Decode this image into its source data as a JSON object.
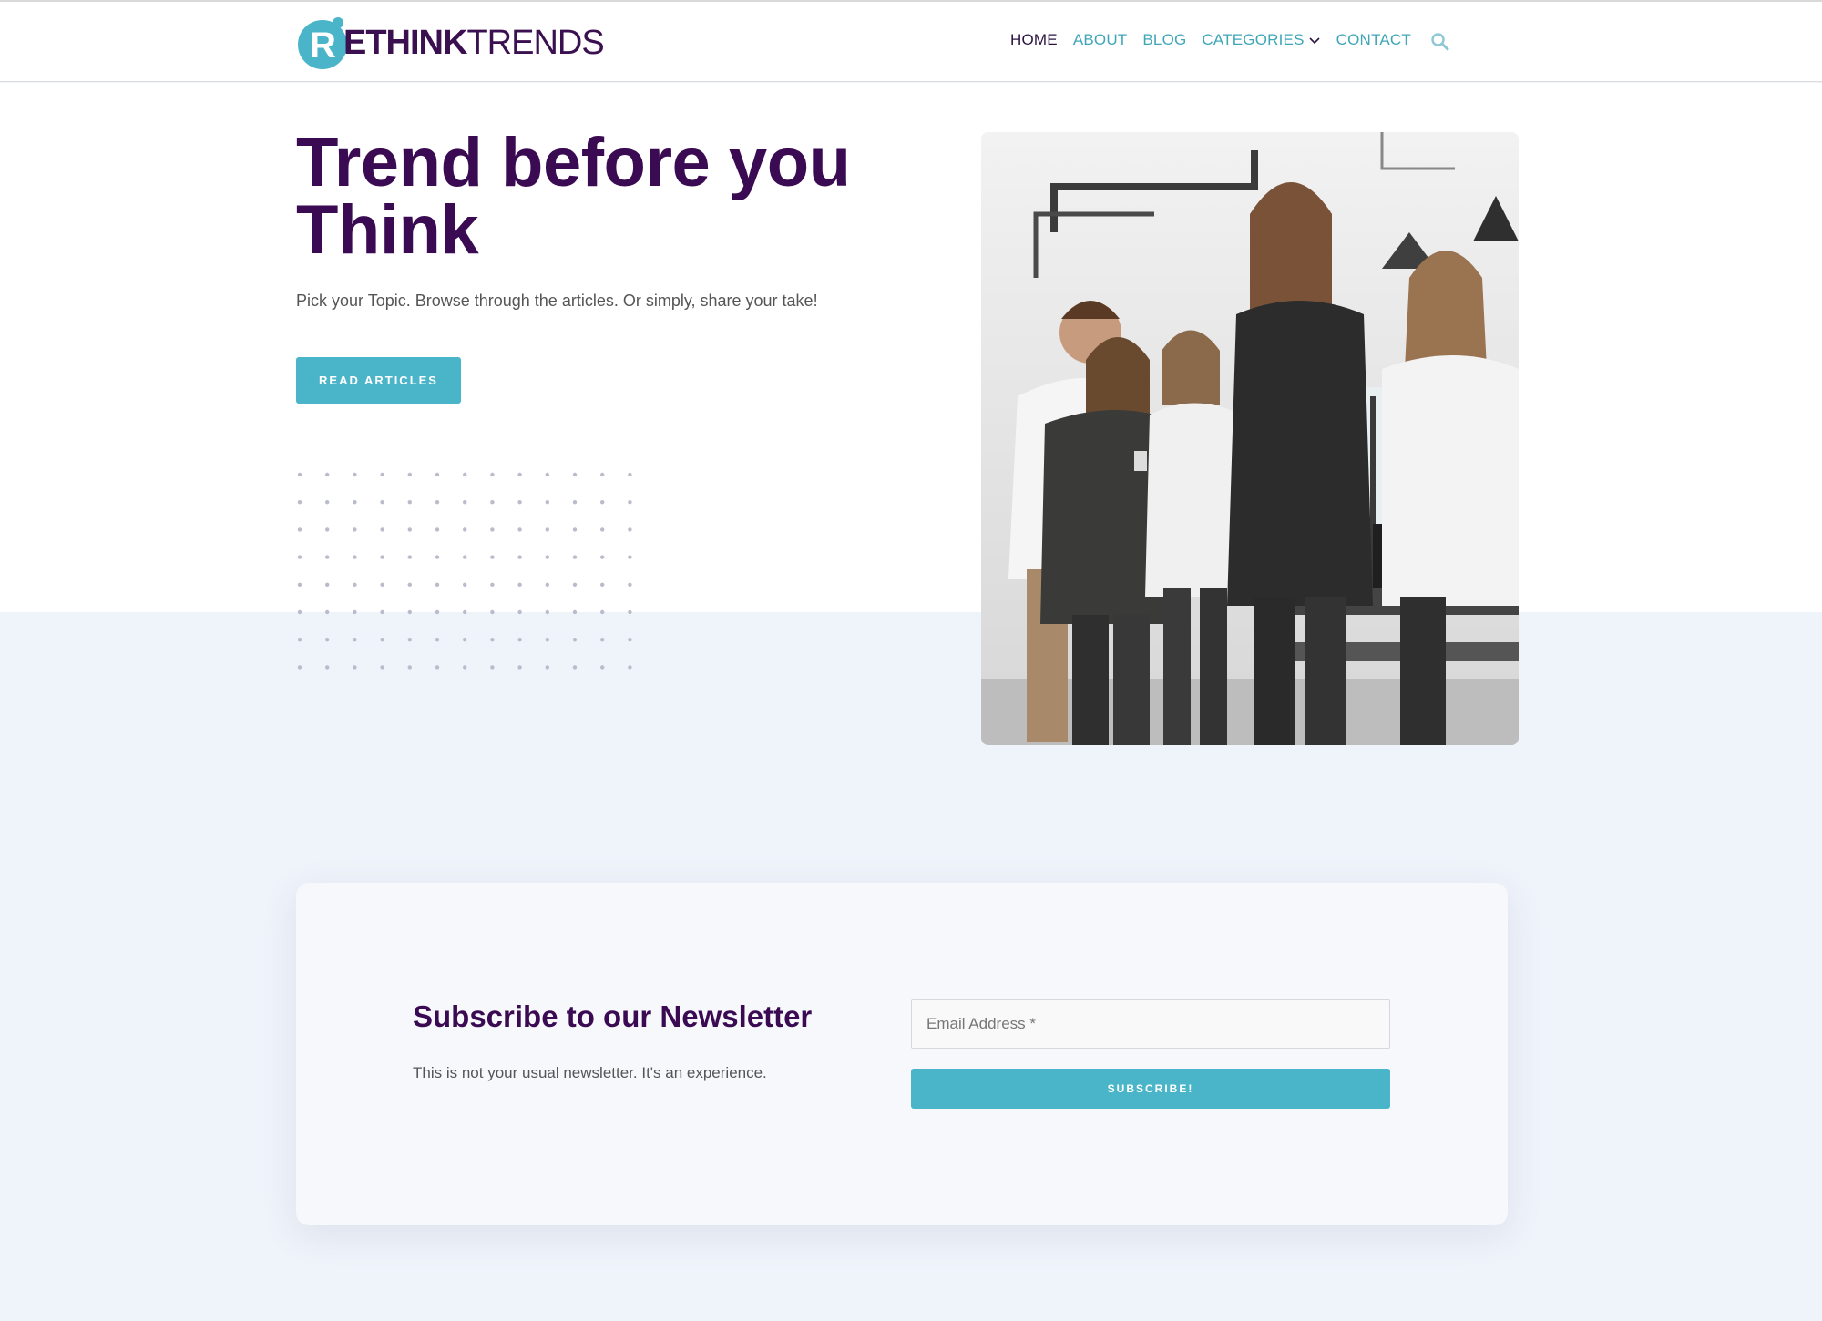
{
  "brand": {
    "logo_text_bold": "ETHINK",
    "logo_text_light": "TRENDS",
    "logo_letter": "R",
    "logo_color": "#3a1050",
    "logo_mark_color": "#4ab5c8"
  },
  "nav": {
    "items": [
      {
        "label": "HOME",
        "active": true
      },
      {
        "label": "ABOUT",
        "active": false
      },
      {
        "label": "BLOG",
        "active": false
      },
      {
        "label": "CATEGORIES",
        "active": false,
        "has_dropdown": true
      },
      {
        "label": "CONTACT",
        "active": false
      }
    ],
    "search_icon": "search-icon"
  },
  "hero": {
    "title_line1": "Trend before you",
    "title_line2": "Think",
    "subtitle": "Pick your Topic. Browse through the articles. Or simply, share your take!",
    "button_label": "READ ARTICLES"
  },
  "newsletter": {
    "title": "Subscribe to our Newsletter",
    "description": "This is not your usual newsletter. It's an experience.",
    "email_placeholder": "Email Address *",
    "button_label": "SUBSCRIBE!"
  },
  "colors": {
    "accent": "#4ab5c8",
    "heading": "#3a0a52",
    "page_bg": "#eff3fa"
  }
}
